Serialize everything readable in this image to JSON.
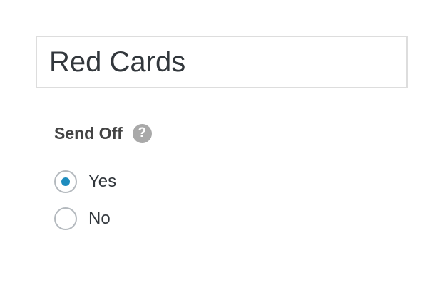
{
  "title_field": {
    "value": "Red Cards"
  },
  "send_off": {
    "label": "Send Off",
    "help_icon": "question-mark-icon",
    "help_glyph": "?",
    "options": [
      {
        "label": "Yes",
        "checked": true
      },
      {
        "label": "No",
        "checked": false
      }
    ]
  },
  "colors": {
    "accent": "#1e8cbe",
    "help_icon_bg": "#a9a9a9",
    "input_border": "#dddddd"
  }
}
